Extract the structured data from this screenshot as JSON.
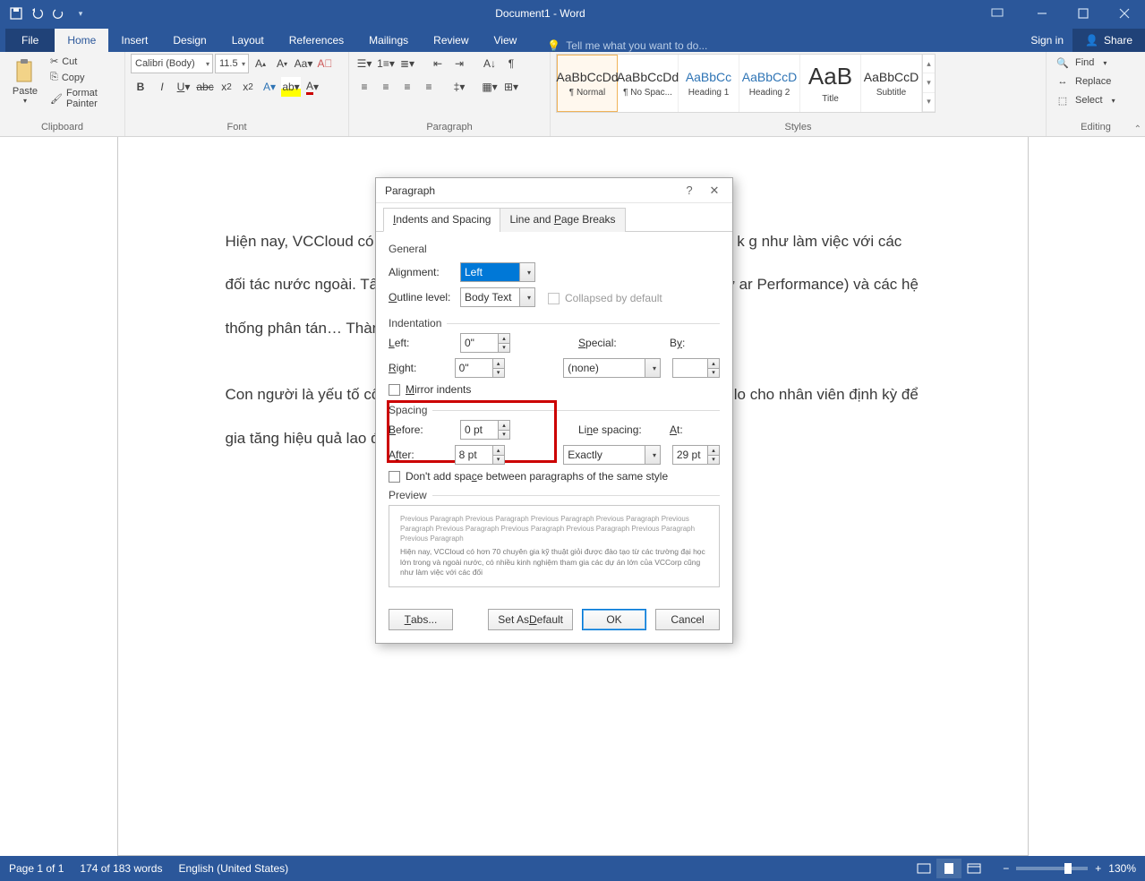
{
  "titlebar": {
    "title": "Document1 - Word"
  },
  "menutabs": {
    "file": "File",
    "home": "Home",
    "insert": "Insert",
    "design": "Design",
    "layout": "Layout",
    "references": "References",
    "mailings": "Mailings",
    "review": "Review",
    "view": "View",
    "tellme_placeholder": "Tell me what you want to do...",
    "signin": "Sign in",
    "share": "Share"
  },
  "ribbon": {
    "clipboard": {
      "paste": "Paste",
      "cut": "Cut",
      "copy": "Copy",
      "fmt": "Format Painter",
      "label": "Clipboard"
    },
    "font": {
      "name": "Calibri (Body)",
      "size": "11.5",
      "label": "Font"
    },
    "paragraph": {
      "label": "Paragraph"
    },
    "styles": {
      "label": "Styles",
      "items": [
        {
          "sample": "AaBbCcDd",
          "name": "¶ Normal",
          "blue": false
        },
        {
          "sample": "AaBbCcDd",
          "name": "¶ No Spac...",
          "blue": false
        },
        {
          "sample": "AaBbCc",
          "name": "Heading 1",
          "blue": true
        },
        {
          "sample": "AaBbCcD",
          "name": "Heading 2",
          "blue": true
        },
        {
          "sample": "AaB",
          "name": "Title",
          "blue": false,
          "big": true
        },
        {
          "sample": "AaBbCcD",
          "name": "Subtitle",
          "blue": false
        }
      ]
    },
    "editing": {
      "find": "Find",
      "replace": "Replace",
      "select": "Select",
      "label": "Editing"
    }
  },
  "doc": {
    "p1": "Hiện nay, VCCloud có hơn                                                                       ường đại học lớn trong và ngoài nước, có nhiều k                                                                        g như làm việc với các đối tác nước ngoài. Tất cả                                                                              ống CCNA, Bảo mật hệ thống mạng CEH, Kỹ sư ar                                                                         Performance) và các hệ thống phân tán… Thành t                                                                             PHP, Ruby,…",
    "p2": "Con người là yếu tố cốt lõ                                                                           g nhân tài là chiến lược lâu dài của công ty, VCClo                                                                         cho nhân viên định kỳ để gia tăng hiệu quả lao đ                                                                            ất để các cá nhân phát huy được hết khả năng củ"
  },
  "dialog": {
    "title": "Paragraph",
    "tab_indents": "Indents and Spacing",
    "tab_breaks": "Line and Page Breaks",
    "general": "General",
    "alignment_lbl": "Alignment:",
    "alignment_val": "Left",
    "outline_lbl": "Outline level:",
    "outline_val": "Body Text",
    "collapsed": "Collapsed by default",
    "indentation": "Indentation",
    "left_lbl": "Left:",
    "left_val": "0\"",
    "right_lbl": "Right:",
    "right_val": "0\"",
    "special_lbl": "Special:",
    "special_val": "(none)",
    "by_lbl": "By:",
    "by_val": "",
    "mirror": "Mirror indents",
    "spacing": "Spacing",
    "before_lbl": "Before:",
    "before_val": "0 pt",
    "after_lbl": "After:",
    "after_val": "8 pt",
    "linespacing_lbl": "Line spacing:",
    "linespacing_val": "Exactly",
    "at_lbl": "At:",
    "at_val": "29 pt",
    "dontadd": "Don't add space between paragraphs of the same style",
    "preview": "Preview",
    "preview_grey": "Previous Paragraph Previous Paragraph Previous Paragraph Previous Paragraph Previous Paragraph Previous Paragraph Previous Paragraph Previous Paragraph Previous Paragraph Previous Paragraph",
    "preview_real": "Hiện nay, VCCloud có hơn 70 chuyên gia kỹ thuật giỏi được đào tạo từ các trường đại học lớn trong và ngoài nước, có nhiều kinh nghiệm tham gia các dự án lớn của VCCorp cũng như làm việc với các đối",
    "btn_tabs": "Tabs...",
    "btn_default": "Set As Default",
    "btn_ok": "OK",
    "btn_cancel": "Cancel"
  },
  "status": {
    "page": "Page 1 of 1",
    "words": "174 of 183 words",
    "lang": "English (United States)",
    "zoom": "130%"
  }
}
